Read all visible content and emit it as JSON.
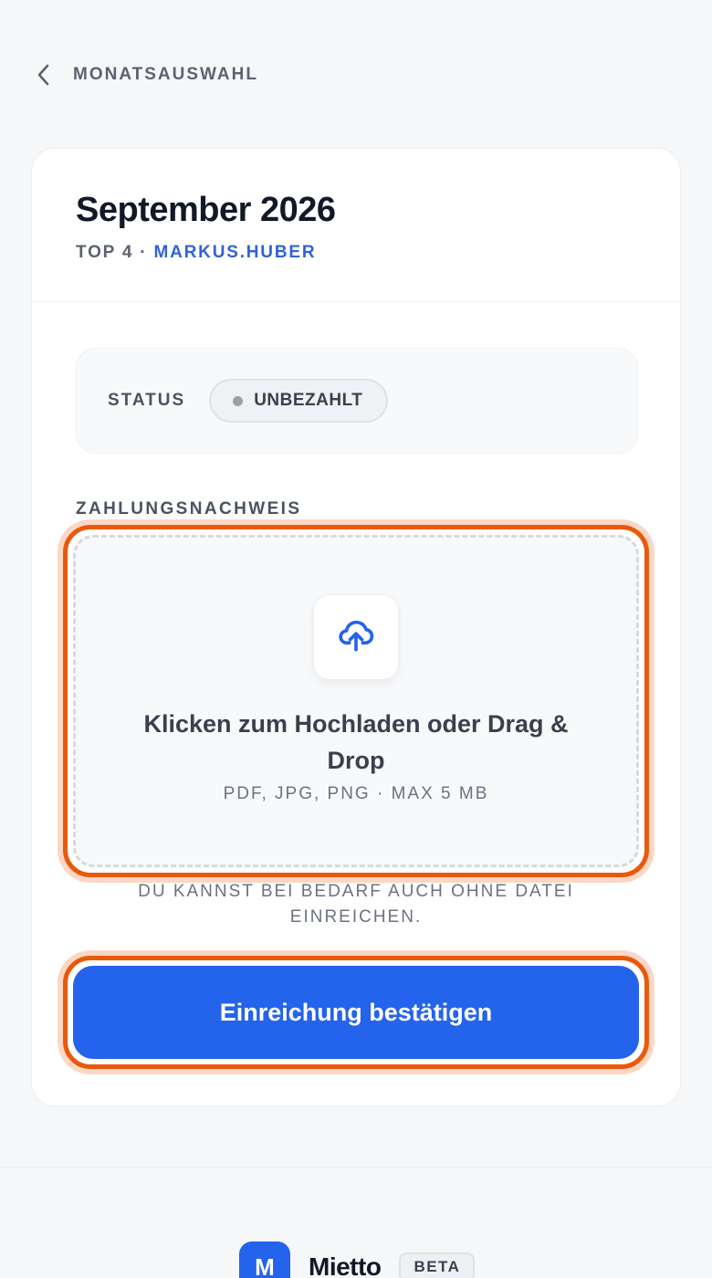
{
  "nav": {
    "back_label": "MONATSAUSWAHL"
  },
  "header": {
    "title": "September 2026",
    "meta_prefix": "TOP 4 · ",
    "user": "MARKUS.HUBER"
  },
  "status": {
    "label": "STATUS",
    "value": "UNBEZAHLT"
  },
  "upload": {
    "section_label": "ZAHLUNGSNACHWEIS",
    "main_text": "Klicken zum Hochladen oder Drag & Drop",
    "sub_text": "PDF, JPG, PNG · MAX 5 MB",
    "hint": "DU KANNST BEI BEDARF AUCH OHNE DATEI EINREICHEN."
  },
  "submit": {
    "label": "Einreichung bestätigen"
  },
  "footer": {
    "logo_letter": "M",
    "brand": "Mietto",
    "badge": "BETA"
  },
  "colors": {
    "accent": "#2463eb",
    "highlight": "#e8590c",
    "user_link": "#2f63d6"
  },
  "icons": {
    "back": "chevron-left-icon",
    "upload": "cloud-upload-icon",
    "status_dot": "status-dot"
  }
}
